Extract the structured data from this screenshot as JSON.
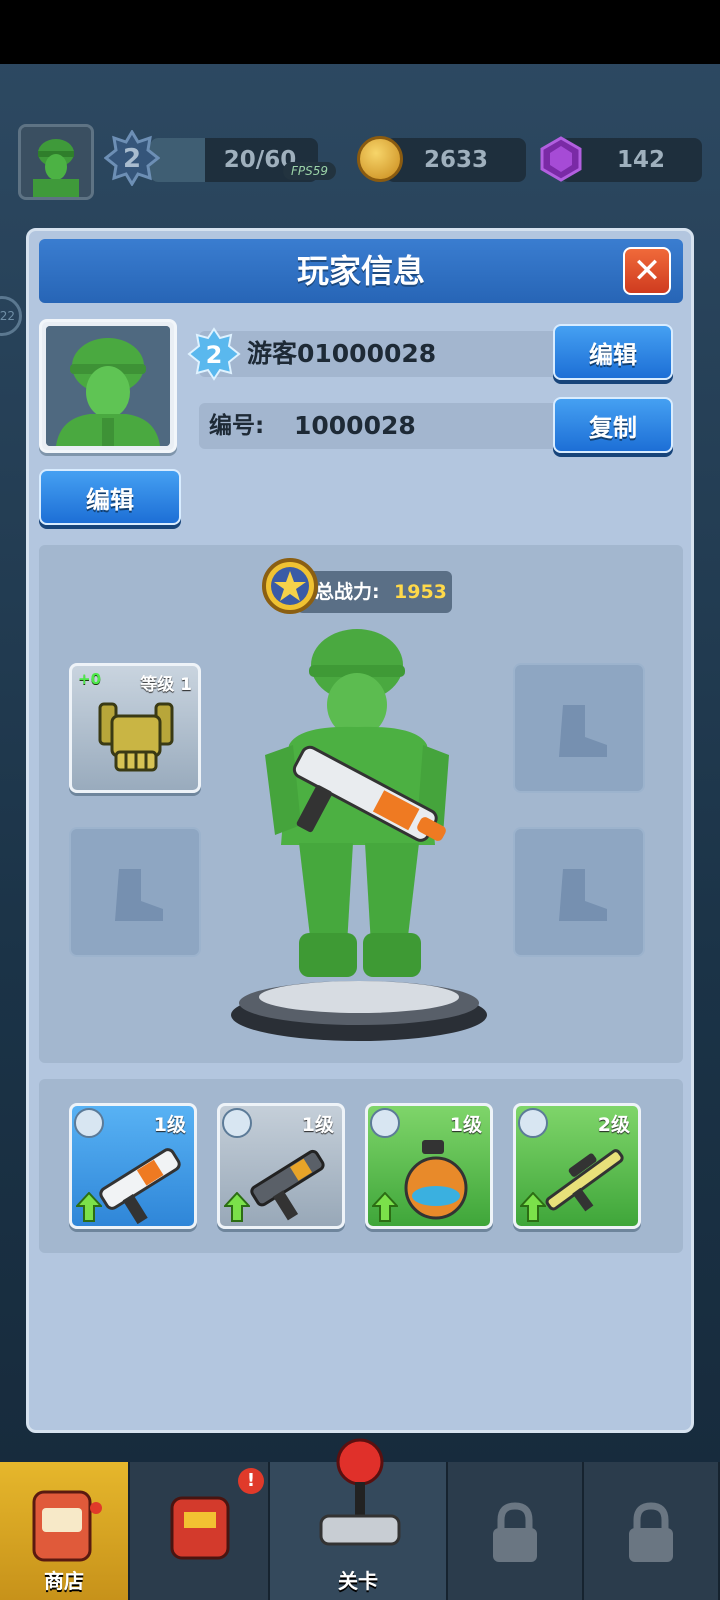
{
  "hud": {
    "level": "2",
    "xp_text": "20/60",
    "xp_progress": 0.33,
    "fps_text": "FPS59",
    "coins": "2633",
    "gems": "142"
  },
  "side_badge": "22",
  "panel": {
    "title": "玩家信息",
    "close_label": "✕",
    "player_level": "2",
    "player_name": "游客01000028",
    "id_label": "编号:",
    "id_value": "1000028",
    "edit_name_label": "编辑",
    "copy_label": "复制",
    "edit_avatar_label": "编辑"
  },
  "equipment": {
    "power_label": "总战力:",
    "power_value": "1953",
    "glove_slot": {
      "plus": "+0",
      "level": "等级 1"
    },
    "empty_slots": [
      "boot-icon",
      "boot-icon",
      "boot-icon"
    ]
  },
  "weapons": [
    {
      "type_icon": "rifle-icon",
      "level": "1级",
      "color": "#3f95e2"
    },
    {
      "type_icon": "rifle-icon",
      "level": "1级",
      "color": "#a8b6c4"
    },
    {
      "type_icon": "grenade-icon",
      "level": "1级",
      "color": "#5cc04f"
    },
    {
      "type_icon": "sniper-icon",
      "level": "2级",
      "color": "#5cc04f"
    }
  ],
  "bottom_nav": {
    "shop_label": "商店",
    "badge": "!",
    "level_label": "关卡"
  }
}
